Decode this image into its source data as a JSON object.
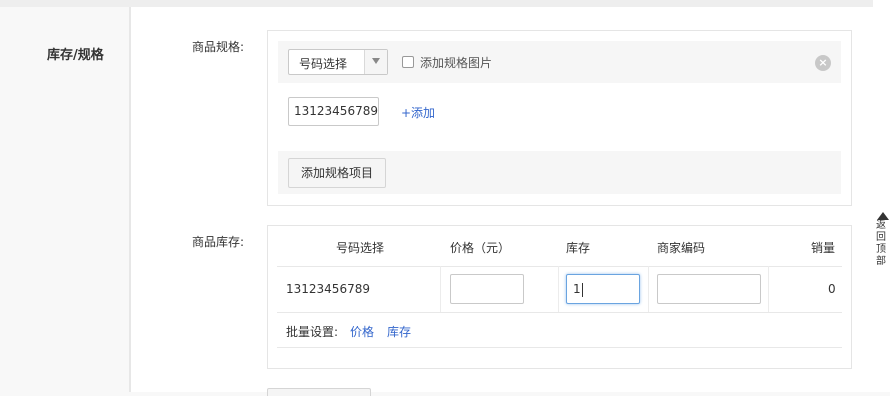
{
  "section": {
    "title": "库存/规格"
  },
  "spec": {
    "label": "商品规格:",
    "select_value": "号码选择",
    "checkbox_label": "添加规格图片",
    "close_symbol": "×",
    "value_input": "13123456789",
    "add_link": "+添加",
    "add_item_button": "添加规格项目"
  },
  "stock": {
    "label": "商品库存:",
    "columns": [
      "号码选择",
      "价格（元）",
      "库存",
      "商家编码",
      "销量"
    ],
    "row": {
      "spec_value": "13123456789",
      "price": "",
      "stock": "1",
      "sku_code": "",
      "sales": "0"
    },
    "batch_label": "批量设置:",
    "batch_price": "价格",
    "batch_stock": "库存"
  },
  "back_to_top": {
    "text": "返回顶部"
  },
  "colors": {
    "link": "#3366cc",
    "focus": "#6aa4e0",
    "panel": "#f6f6f6"
  }
}
